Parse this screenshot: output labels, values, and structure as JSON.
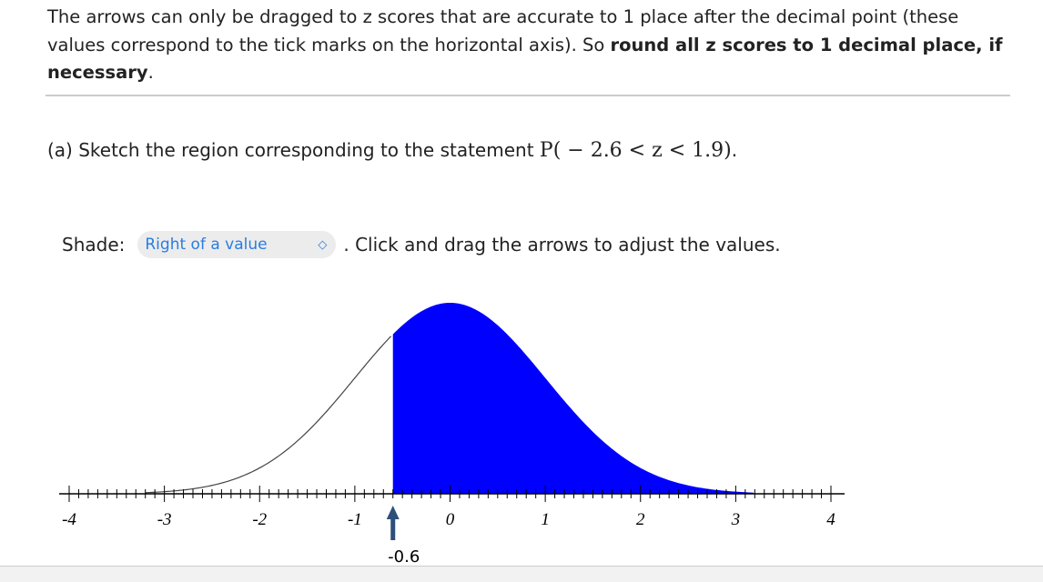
{
  "intro": {
    "text1": "The arrows can only be dragged to z scores that are accurate to 1 place after the decimal point (these values correspond to the tick marks on the horizontal axis). So ",
    "bold": "round all z scores to 1 decimal place, if necessary",
    "text2": "."
  },
  "question": {
    "label": "(a) Sketch the region corresponding to the statement ",
    "math": "P( − 2.6 < z < 1.9)",
    "end": "."
  },
  "shade": {
    "label": "Shade:",
    "selected": "Right of a value",
    "icon": "chevron-updown-icon",
    "after": ". Click and drag the arrows to adjust the values."
  },
  "chart_data": {
    "type": "area",
    "distribution": "standard normal",
    "xlim": [
      -4,
      4
    ],
    "tick_step": 0.1,
    "tick_labels": [
      "-4",
      "-3",
      "-2",
      "-1",
      "0",
      "1",
      "2",
      "3",
      "4"
    ],
    "shaded_region": "right",
    "arrow_value": -0.6,
    "arrow_label": "-0.6",
    "fill_color": "#0000ff",
    "arrow_color": "#2f4f7a"
  }
}
